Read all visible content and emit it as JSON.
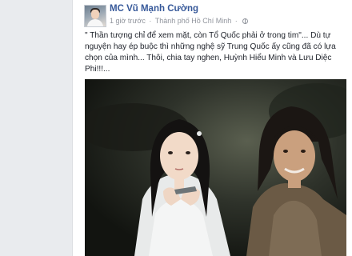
{
  "post": {
    "author": "MC Vũ Mạnh Cường",
    "time": "1 giờ trước",
    "separator": "·",
    "location": "Thành phố Hồ Chí Minh",
    "privacy_icon": "globe-icon",
    "text": "\" Thần tượng chỉ để xem mặt, còn Tổ Quốc phải ở trong tim\"... Dù tự nguyện hay ép buộc thì những nghệ sỹ Trung Quốc ấy cũng đã có lựa chọn của mình... Thôi, chia tay nghen, Huỳnh Hiểu Minh và Lưu Diệc Phi!!!..."
  },
  "colors": {
    "page_bg": "#e9ebee",
    "author_link": "#365899",
    "meta_text": "#90949c",
    "body_text": "#1d2129"
  }
}
